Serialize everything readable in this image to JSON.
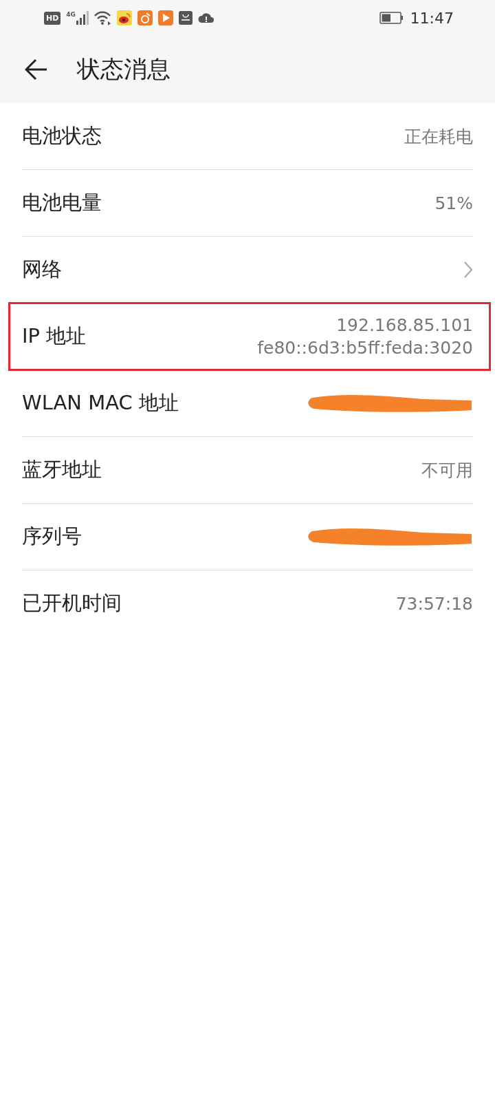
{
  "status_bar": {
    "hd_badge": "HD",
    "network_type": "4G",
    "time": "11:47",
    "battery": {
      "level": 0.5
    }
  },
  "header": {
    "title": "状态消息"
  },
  "rows": [
    {
      "label": "电池状态",
      "kind": "text",
      "values": [
        "正在耗电"
      ],
      "highlighted": false
    },
    {
      "label": "电池电量",
      "kind": "text",
      "values": [
        "51%"
      ],
      "highlighted": false
    },
    {
      "label": "网络",
      "kind": "chevron",
      "highlighted": false
    },
    {
      "label": "IP 地址",
      "kind": "text",
      "values": [
        "192.168.85.101",
        "fe80::6d3:b5ff:feda:3020"
      ],
      "highlighted": true
    },
    {
      "label": "WLAN MAC 地址",
      "kind": "redacted",
      "highlighted": false
    },
    {
      "label": "蓝牙地址",
      "kind": "text",
      "values": [
        "不可用"
      ],
      "highlighted": false
    },
    {
      "label": "序列号",
      "kind": "redacted",
      "highlighted": false
    },
    {
      "label": "已开机时间",
      "kind": "text",
      "values": [
        "73:57:18"
      ],
      "highlighted": false
    }
  ]
}
